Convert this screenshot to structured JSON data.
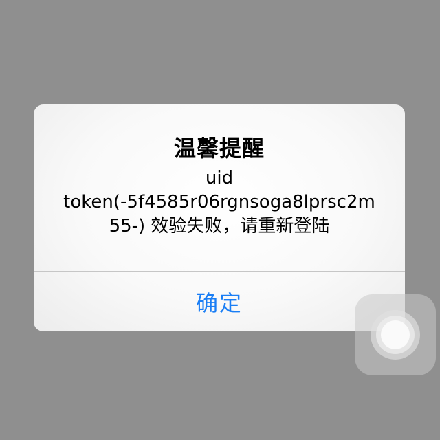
{
  "alert": {
    "title": "温馨提醒",
    "message_lines": [
      "uid",
      "token(-5f4585r06rgnsoga8lprsc2m",
      "55-) 效验失败，请重新登陆"
    ],
    "confirm_label": "确定"
  },
  "colors": {
    "backdrop": "#8f8f8f",
    "alert_background": "#f9f9f9",
    "button_text": "#1a7ef5",
    "divider": "#c6c6c6"
  },
  "icons": {
    "assistive_touch": "assistive-touch-icon"
  }
}
